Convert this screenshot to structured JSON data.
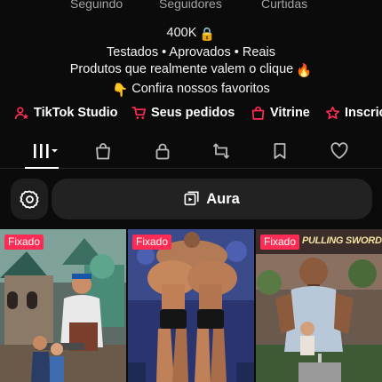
{
  "stats": {
    "following_label": "Seguindo",
    "followers_label": "Seguidores",
    "likes_label": "Curtidas"
  },
  "bio": {
    "line1": "400K",
    "line2": "Testados • Aprovados • Reais",
    "line3": "Produtos que realmente valem o clique",
    "line4": "Confira nossos favoritos",
    "emoji_lock": "🔒",
    "emoji_fire": "🔥",
    "emoji_point": "👇"
  },
  "links": [
    {
      "label": "TikTok Studio",
      "icon": "person-star-icon"
    },
    {
      "label": "Seus pedidos",
      "icon": "cart-icon"
    },
    {
      "label": "Vitrine",
      "icon": "shopping-bag-icon"
    },
    {
      "label": "Inscric",
      "icon": "star-icon"
    }
  ],
  "accent_color": "#fe2c55",
  "tabs": [
    {
      "name": "videos",
      "icon": "grid-icon",
      "active": true
    },
    {
      "name": "shop",
      "icon": "bag-icon"
    },
    {
      "name": "private",
      "icon": "lock-icon"
    },
    {
      "name": "reposts",
      "icon": "repost-icon"
    },
    {
      "name": "favorites",
      "icon": "bookmark-icon"
    },
    {
      "name": "liked",
      "icon": "heart-icon"
    }
  ],
  "search": {
    "label": "Aura",
    "icon": "video-icon"
  },
  "videos": [
    {
      "pinned_label": "Fixado"
    },
    {
      "pinned_label": "Fixado"
    },
    {
      "pinned_label": "Fixado",
      "overlay_text": "PULLING SWORD"
    }
  ]
}
